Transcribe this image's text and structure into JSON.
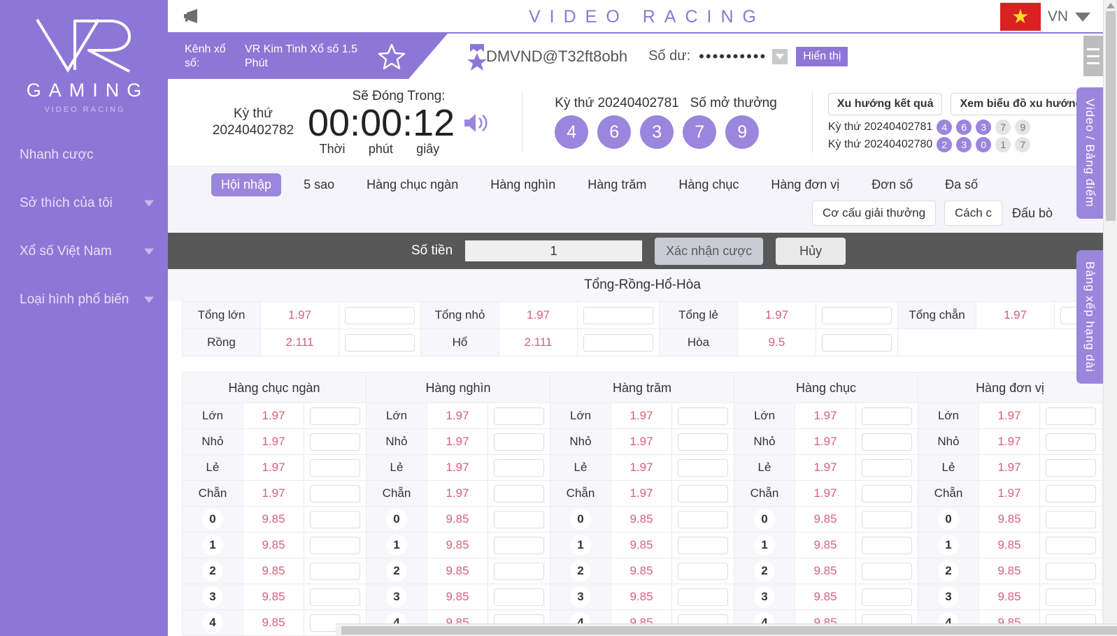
{
  "sidebar": {
    "logo_main": "VR",
    "logo_word": "GAMING",
    "logo_sub": "VIDEO RACING",
    "items": [
      {
        "label": "Nhanh cược",
        "has_caret": false
      },
      {
        "label": "Sở thích của tôi",
        "has_caret": true
      },
      {
        "label": "Xổ số Việt Nam",
        "has_caret": true
      },
      {
        "label": "Loại hình phổ biến",
        "has_caret": true
      }
    ]
  },
  "topbar": {
    "megaphone_icon": "megaphone-icon",
    "brand": "VIDEO RACING",
    "lang_code": "VN",
    "flag_icon": "vietnam-flag-icon",
    "caret_icon": "chevron-down-icon"
  },
  "account": {
    "channel_label": "Kênh xổ số:",
    "channel_value": "VR Kim Tinh Xổ số 1.5 Phút",
    "star_icon": "star-outline-icon",
    "medal_icon": "medal-icon",
    "username": "DMVND@T32ft8obh",
    "balance_label": "Số dư:",
    "balance_masked": "••••••••••",
    "balance_toggle_icon": "chevron-down-icon",
    "show_button": "Hiển thị",
    "menu_icon": "hamburger-menu-icon"
  },
  "draw": {
    "current_label": "Kỳ thứ",
    "current_issue": "20240402782",
    "closing_title": "Sẽ Đóng Trong:",
    "countdown": "00:00:12",
    "unit_hours": "Thời",
    "unit_minutes": "phút",
    "unit_seconds": "giây",
    "sound_icon": "speaker-icon",
    "result_issue_label": "Kỳ thứ 20240402781",
    "result_title": "Số mở thưởng",
    "result_balls": [
      "4",
      "6",
      "3",
      "7",
      "9"
    ]
  },
  "trend": {
    "buttons": [
      "Xu hướng kết quả",
      "Xem biểu đồ xu hướng"
    ],
    "history": [
      {
        "issue": "Kỳ thứ 20240402781",
        "digits": [
          "4",
          "6",
          "3",
          "7",
          "9"
        ],
        "highlight": [
          true,
          true,
          true,
          false,
          false
        ]
      },
      {
        "issue": "Kỳ thứ 20240402780",
        "digits": [
          "2",
          "3",
          "0",
          "1",
          "7"
        ],
        "highlight": [
          true,
          true,
          true,
          false,
          false
        ]
      }
    ]
  },
  "tabs": {
    "items": [
      {
        "label": "Hội nhập",
        "active": true
      },
      {
        "label": "5 sao",
        "active": false
      },
      {
        "label": "Hàng chục ngàn",
        "active": false
      },
      {
        "label": "Hàng nghìn",
        "active": false
      },
      {
        "label": "Hàng trăm",
        "active": false
      },
      {
        "label": "Hàng chục",
        "active": false
      },
      {
        "label": "Hàng đơn vị",
        "active": false
      },
      {
        "label": "Đơn số",
        "active": false
      },
      {
        "label": "Đa số",
        "active": false
      },
      {
        "label": "Đấu bò",
        "active": false
      }
    ],
    "right_buttons": [
      "Cơ cấu giải thưởng",
      "Cách c"
    ]
  },
  "betbar": {
    "amount_label": "Số tiền",
    "amount_value": "1",
    "confirm_label": "Xác nhận cược",
    "cancel_label": "Hủy"
  },
  "trh": {
    "title": "Tổng-Rồng-Hổ-Hòa",
    "rows": [
      [
        {
          "label": "Tổng lớn",
          "odds": "1.97"
        },
        {
          "label": "Tổng nhỏ",
          "odds": "1.97"
        },
        {
          "label": "Tổng lẻ",
          "odds": "1.97"
        },
        {
          "label": "Tổng chẵn",
          "odds": "1.97"
        }
      ],
      [
        {
          "label": "Rồng",
          "odds": "2.111"
        },
        {
          "label": "Hổ",
          "odds": "2.111"
        },
        {
          "label": "Hòa",
          "odds": "9.5"
        }
      ]
    ]
  },
  "grid": {
    "columns": [
      {
        "header": "Hàng chục ngàn"
      },
      {
        "header": "Hàng nghìn"
      },
      {
        "header": "Hàng trăm"
      },
      {
        "header": "Hàng chục"
      },
      {
        "header": "Hàng đơn vị"
      }
    ],
    "rows": [
      {
        "label": "Lớn",
        "odds": "1.97",
        "is_num": false
      },
      {
        "label": "Nhỏ",
        "odds": "1.97",
        "is_num": false
      },
      {
        "label": "Lẻ",
        "odds": "1.97",
        "is_num": false
      },
      {
        "label": "Chẵn",
        "odds": "1.97",
        "is_num": false
      },
      {
        "label": "0",
        "odds": "9.85",
        "is_num": true
      },
      {
        "label": "1",
        "odds": "9.85",
        "is_num": true
      },
      {
        "label": "2",
        "odds": "9.85",
        "is_num": true
      },
      {
        "label": "3",
        "odds": "9.85",
        "is_num": true
      },
      {
        "label": "4",
        "odds": "9.85",
        "is_num": true
      }
    ]
  },
  "vtabs": {
    "video": "Video / Bảng điểm",
    "rank": "Bảng xếp hạng dài"
  },
  "colors": {
    "brand_purple": "#8d77d6",
    "accent_purple": "#9b86dd",
    "odds_red": "#d9607a",
    "betbar_gray": "#585858"
  }
}
